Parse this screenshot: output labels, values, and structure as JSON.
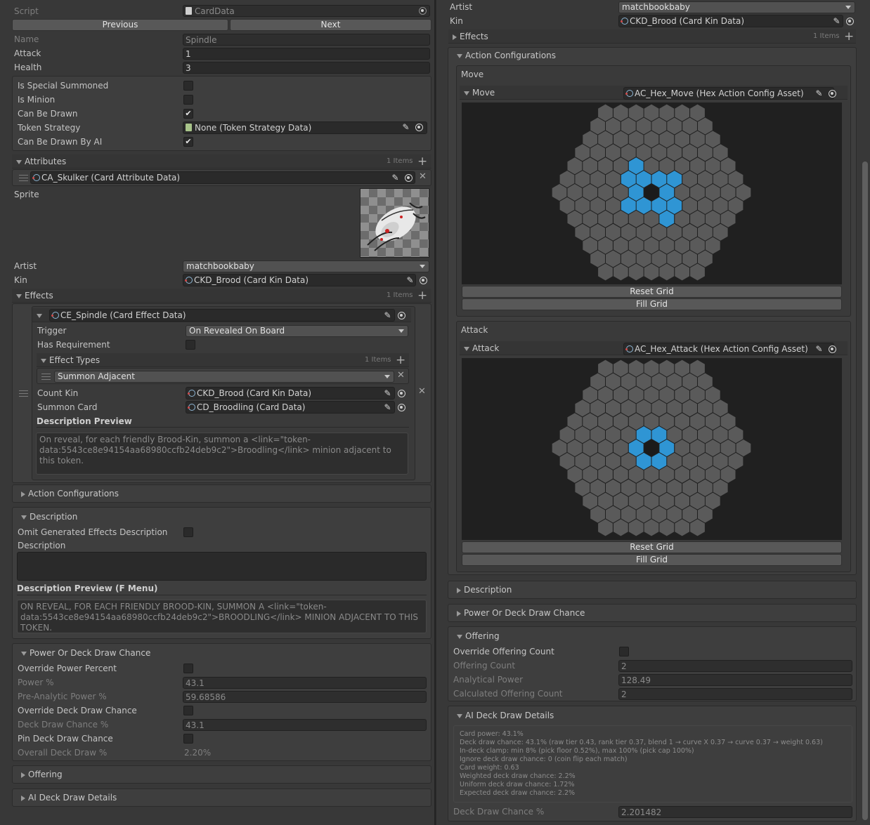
{
  "left": {
    "script": {
      "label": "Script",
      "value": "CardData"
    },
    "nav": {
      "previous": "Previous",
      "next": "Next"
    },
    "name": {
      "label": "Name",
      "value": "Spindle"
    },
    "attack": {
      "label": "Attack",
      "value": "1"
    },
    "health": {
      "label": "Health",
      "value": "3"
    },
    "flags": {
      "special": {
        "label": "Is Special Summoned",
        "checked": false
      },
      "minion": {
        "label": "Is Minion",
        "checked": false
      },
      "drawn": {
        "label": "Can Be Drawn",
        "checked": true
      },
      "token": {
        "label": "Token Strategy",
        "value": "None (Token Strategy Data)"
      },
      "drawnAI": {
        "label": "Can Be Drawn By AI",
        "checked": true
      }
    },
    "attributes": {
      "label": "Attributes",
      "count": "1 Items",
      "item": "CA_Skulker (Card Attribute Data)"
    },
    "sprite": {
      "label": "Sprite"
    },
    "artist": {
      "label": "Artist",
      "value": "matchbookbaby"
    },
    "kin": {
      "label": "Kin",
      "value": "CKD_Brood (Card Kin Data)"
    },
    "effects": {
      "label": "Effects",
      "count": "1 Items",
      "item": "CE_Spindle (Card Effect Data)",
      "trigger": {
        "label": "Trigger",
        "value": "On Revealed On Board"
      },
      "hasReq": {
        "label": "Has Requirement",
        "checked": false
      },
      "effectTypes": {
        "label": "Effect Types",
        "count": "1 Items",
        "value": "Summon Adjacent"
      },
      "countKin": {
        "label": "Count Kin",
        "value": "CKD_Brood (Card Kin Data)"
      },
      "summonCard": {
        "label": "Summon Card",
        "value": "CD_Broodling (Card Data)"
      },
      "descPreviewLabel": "Description Preview",
      "descPreview": "On reveal, for each friendly Brood-Kin, summon a <link=\"token-data:5543ce8e94154aa68980ccfb24deb9c2\">Broodling</link> minion adjacent to this token."
    },
    "actionConfigs": "Action Configurations",
    "description": {
      "label": "Description",
      "omit": {
        "label": "Omit Generated Effects Description",
        "checked": false
      },
      "descLabel": "Description",
      "previewLabel": "Description Preview (F Menu)",
      "preview": "ON REVEAL, FOR EACH FRIENDLY BROOD-KIN, SUMMON A <link=\"token-data:5543ce8e94154aa68980ccfb24deb9c2\">BROODLING</link> MINION ADJACENT TO THIS TOKEN."
    },
    "power": {
      "label": "Power Or Deck Draw Chance",
      "overridePower": {
        "label": "Override Power Percent",
        "checked": false
      },
      "powerPct": {
        "label": "Power %",
        "value": "43.1"
      },
      "preAnalytic": {
        "label": "Pre-Analytic Power %",
        "value": "59.68586"
      },
      "overrideDeck": {
        "label": "Override Deck Draw Chance",
        "checked": false
      },
      "deckDraw": {
        "label": "Deck Draw Chance %",
        "value": "43.1"
      },
      "pinDeck": {
        "label": "Pin Deck Draw Chance",
        "checked": false
      },
      "overall": {
        "label": "Overall Deck Draw %",
        "value": "2.20%"
      }
    },
    "offering": "Offering",
    "aiDeck": "AI Deck Draw Details"
  },
  "right": {
    "artist": {
      "label": "Artist",
      "value": "matchbookbaby"
    },
    "kin": {
      "label": "Kin",
      "value": "CKD_Brood (Card Kin Data)"
    },
    "effects": {
      "label": "Effects",
      "count": "1 Items"
    },
    "actionConfigs": "Action Configurations",
    "move": {
      "section": "Move",
      "label": "Move",
      "asset": "AC_Hex_Move (Hex Action Config Asset)",
      "reset": "Reset Grid",
      "fill": "Fill Grid"
    },
    "attack": {
      "section": "Attack",
      "label": "Attack",
      "asset": "AC_Hex_Attack (Hex Action Config Asset)",
      "reset": "Reset Grid",
      "fill": "Fill Grid"
    },
    "description": "Description",
    "power": "Power Or Deck Draw Chance",
    "offering": {
      "label": "Offering",
      "override": {
        "label": "Override Offering Count",
        "checked": false
      },
      "count": {
        "label": "Offering Count",
        "value": "2"
      },
      "analytical": {
        "label": "Analytical Power",
        "value": "128.49"
      },
      "calculated": {
        "label": "Calculated Offering Count",
        "value": "2"
      }
    },
    "aiDeck": {
      "label": "AI Deck Draw Details",
      "lines": [
        "Card power: 43.1%",
        "Deck draw chance: 43.1% (raw tier 0.43, rank tier 0.37, blend 1 → curve X 0.37 → curve 0.37 → weight 0.63)",
        "In-deck clamp: min 8% (pick floor 0.52%), max 100% (pick cap 100%)",
        "Ignore deck draw chance: 0 (coin flip each match)",
        "Card weight: 0.63",
        "Weighted deck draw chance: 2.2%",
        "Uniform deck draw chance: 1.72%",
        "Expected deck draw chance: 2.2%"
      ],
      "deckDraw": {
        "label": "Deck Draw Chance %",
        "value": "2.201482"
      }
    }
  },
  "colors": {
    "hexBlue": "#2f95d4",
    "hexGray": "#5a5a5a",
    "hexCenter": "#1b1b1b",
    "bg": "#383838"
  },
  "icons": [
    "script-icon",
    "object-icon",
    "pencil-icon",
    "target-icon",
    "plus-icon",
    "close-icon",
    "drag-handle-icon",
    "dropdown-caret-icon",
    "foldout-arrow-icon",
    "checkmark-icon"
  ]
}
